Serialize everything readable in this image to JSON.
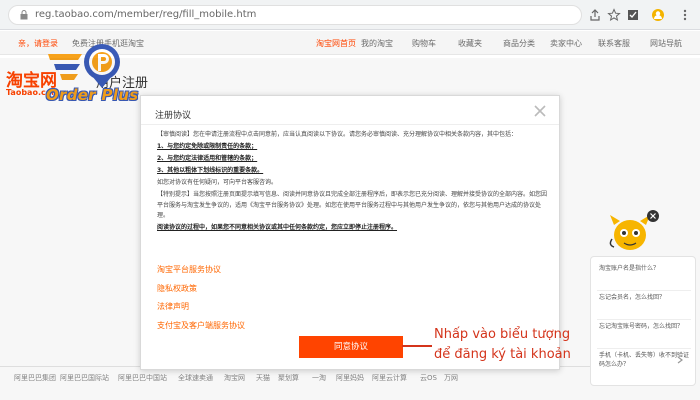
{
  "browser": {
    "url": "reg.taobao.com/member/reg/fill_mobile.htm",
    "icons": [
      "lock-icon",
      "share-icon",
      "star-icon",
      "extension-icon",
      "menu-icon"
    ]
  },
  "topnav": {
    "greeting": "亲，请登录",
    "left_extra": "免费注册",
    "left_extra2": "手机逛淘宝",
    "items": [
      "淘宝网首页",
      "我的淘宝",
      "购物车",
      "收藏夹",
      "商品分类",
      "卖家中心",
      "联系客服",
      "网站导航"
    ]
  },
  "logo": {
    "brand": "淘宝网",
    "domain": "Taobao.com",
    "page_name": "用户注册"
  },
  "watermark": {
    "text": "Order Plus",
    "colors": {
      "orange": "#f7a21b",
      "blue": "#3a5bb8"
    }
  },
  "modal": {
    "title": "注册协议",
    "close_icon": "close-icon",
    "paragraphs": [
      "【审慎阅读】您在申请注册流程中点击同意前，应当认真阅读以下协议。请您务必审慎阅读、充分理解协议中相关条款内容，其中包括：",
      "1、与您约定免除或限制责任的条款；",
      "2、与您约定法律适用和管辖的条款；",
      "3、其他以粗体下划线标识的重要条款。",
      "如您对协议有任何疑问，可向平台客服咨询。",
      "【特别提示】当您按照注册页面提示填写信息、阅读并同意协议且完成全部注册程序后，即表示您已充分阅读、理解并接受协议的全部内容。如您因平台服务与淘宝发生争议的，适用《淘宝平台服务协议》处理。如您在使用平台服务过程中与其他用户发生争议的，依您与其他用户达成的协议处理。",
      "阅读协议的过程中，如果您不同意相关协议或其中任何条款约定，您应立即停止注册程序。"
    ],
    "links": [
      "淘宝平台服务协议",
      "隐私权政策",
      "法律声明",
      "支付宝及客户端服务协议"
    ],
    "agree_button": "同意协议"
  },
  "annotation": {
    "text": "Nhấp vào biểu tượng để đăng ký tài khoản",
    "color": "#d4341b"
  },
  "footer": {
    "items": [
      "阿里巴巴集团",
      "阿里巴巴国际站",
      "阿里巴巴中国站",
      "全球速卖通",
      "淘宝网",
      "天猫",
      "聚划算",
      "一淘",
      "阿里妈妈",
      "阿里云计算",
      "云OS",
      "万网"
    ]
  },
  "help_widget": {
    "items": [
      "淘宝账户名是指什么？",
      "忘记会员名，怎么找回？",
      "忘记淘宝账号密码，怎么找回？",
      "手机（卡机、丢失等）收不到验证码怎么办？"
    ]
  },
  "accent_color": "#ff4400"
}
